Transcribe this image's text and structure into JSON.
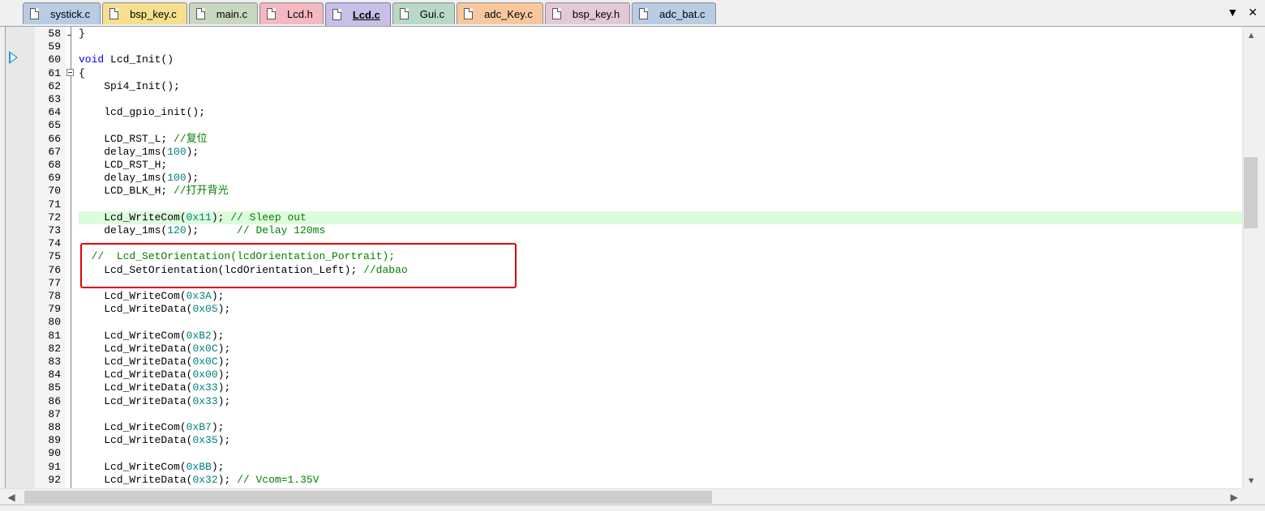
{
  "tabs": [
    {
      "label": "systick.c",
      "color": "#b8cce4"
    },
    {
      "label": "bsp_key.c",
      "color": "#f7df8f"
    },
    {
      "label": "main.c",
      "color": "#c8d8c0"
    },
    {
      "label": "Lcd.h",
      "color": "#f4b8c0"
    },
    {
      "label": "Lcd.c",
      "color": "#c8c0e8",
      "active": true
    },
    {
      "label": "Gui.c",
      "color": "#b8d8c8"
    },
    {
      "label": "adc_Key.c",
      "color": "#f8c89c"
    },
    {
      "label": "bsp_key.h",
      "color": "#e4c8d8"
    },
    {
      "label": "adc_bat.c",
      "color": "#b8cce4"
    }
  ],
  "toolbar": {
    "dropdown_icon": "▼",
    "close_icon": "✕"
  },
  "highlight_line": "72",
  "code_lines": [
    {
      "n": "58",
      "t": [
        [
          "",
          "}"
        ]
      ]
    },
    {
      "n": "59",
      "t": []
    },
    {
      "n": "60",
      "t": [
        [
          "kw",
          "void"
        ],
        [
          "",
          " Lcd_Init()"
        ]
      ]
    },
    {
      "n": "61",
      "t": [
        [
          "",
          "{"
        ]
      ]
    },
    {
      "n": "62",
      "t": [
        [
          "",
          "    Spi4_Init();"
        ]
      ]
    },
    {
      "n": "63",
      "t": []
    },
    {
      "n": "64",
      "t": [
        [
          "",
          "    lcd_gpio_init();"
        ]
      ]
    },
    {
      "n": "65",
      "t": []
    },
    {
      "n": "66",
      "t": [
        [
          "",
          "    LCD_RST_L; "
        ],
        [
          "cm",
          "//复位"
        ]
      ]
    },
    {
      "n": "67",
      "t": [
        [
          "",
          "    delay_1ms("
        ],
        [
          "num",
          "100"
        ],
        [
          "",
          ");"
        ]
      ]
    },
    {
      "n": "68",
      "t": [
        [
          "",
          "    LCD_RST_H;"
        ]
      ]
    },
    {
      "n": "69",
      "t": [
        [
          "",
          "    delay_1ms("
        ],
        [
          "num",
          "100"
        ],
        [
          "",
          ");"
        ]
      ]
    },
    {
      "n": "70",
      "t": [
        [
          "",
          "    LCD_BLK_H; "
        ],
        [
          "cm",
          "//打开背光"
        ]
      ]
    },
    {
      "n": "71",
      "t": []
    },
    {
      "n": "72",
      "t": [
        [
          "",
          "    Lcd_WriteCom("
        ],
        [
          "num",
          "0x11"
        ],
        [
          "",
          "); "
        ],
        [
          "cm",
          "// Sleep out"
        ]
      ]
    },
    {
      "n": "73",
      "t": [
        [
          "",
          "    delay_1ms("
        ],
        [
          "num",
          "120"
        ],
        [
          "",
          ");      "
        ],
        [
          "cm",
          "// Delay 120ms"
        ]
      ]
    },
    {
      "n": "74",
      "t": []
    },
    {
      "n": "75",
      "t": [
        [
          "cm",
          "  //  Lcd_SetOrientation(lcdOrientation_Portrait);"
        ]
      ]
    },
    {
      "n": "76",
      "t": [
        [
          "",
          "    Lcd_SetOrientation(lcdOrientation_Left); "
        ],
        [
          "cm",
          "//dabao"
        ]
      ]
    },
    {
      "n": "77",
      "t": []
    },
    {
      "n": "78",
      "t": [
        [
          "",
          "    Lcd_WriteCom("
        ],
        [
          "num",
          "0x3A"
        ],
        [
          "",
          ");"
        ]
      ]
    },
    {
      "n": "79",
      "t": [
        [
          "",
          "    Lcd_WriteData("
        ],
        [
          "num",
          "0x05"
        ],
        [
          "",
          ");"
        ]
      ]
    },
    {
      "n": "80",
      "t": []
    },
    {
      "n": "81",
      "t": [
        [
          "",
          "    Lcd_WriteCom("
        ],
        [
          "num",
          "0xB2"
        ],
        [
          "",
          ");"
        ]
      ]
    },
    {
      "n": "82",
      "t": [
        [
          "",
          "    Lcd_WriteData("
        ],
        [
          "num",
          "0x0C"
        ],
        [
          "",
          ");"
        ]
      ]
    },
    {
      "n": "83",
      "t": [
        [
          "",
          "    Lcd_WriteData("
        ],
        [
          "num",
          "0x0C"
        ],
        [
          "",
          ");"
        ]
      ]
    },
    {
      "n": "84",
      "t": [
        [
          "",
          "    Lcd_WriteData("
        ],
        [
          "num",
          "0x00"
        ],
        [
          "",
          ");"
        ]
      ]
    },
    {
      "n": "85",
      "t": [
        [
          "",
          "    Lcd_WriteData("
        ],
        [
          "num",
          "0x33"
        ],
        [
          "",
          ");"
        ]
      ]
    },
    {
      "n": "86",
      "t": [
        [
          "",
          "    Lcd_WriteData("
        ],
        [
          "num",
          "0x33"
        ],
        [
          "",
          ");"
        ]
      ]
    },
    {
      "n": "87",
      "t": []
    },
    {
      "n": "88",
      "t": [
        [
          "",
          "    Lcd_WriteCom("
        ],
        [
          "num",
          "0xB7"
        ],
        [
          "",
          ");"
        ]
      ]
    },
    {
      "n": "89",
      "t": [
        [
          "",
          "    Lcd_WriteData("
        ],
        [
          "num",
          "0x35"
        ],
        [
          "",
          ");"
        ]
      ]
    },
    {
      "n": "90",
      "t": []
    },
    {
      "n": "91",
      "t": [
        [
          "",
          "    Lcd_WriteCom("
        ],
        [
          "num",
          "0xBB"
        ],
        [
          "",
          ");"
        ]
      ]
    },
    {
      "n": "92",
      "t": [
        [
          "",
          "    Lcd_WriteData("
        ],
        [
          "num",
          "0x32"
        ],
        [
          "",
          "); "
        ],
        [
          "cm",
          "// Vcom=1.35V"
        ]
      ]
    }
  ],
  "scroll": {
    "up": "▲",
    "down": "▼",
    "left": "◀",
    "right": "▶"
  }
}
